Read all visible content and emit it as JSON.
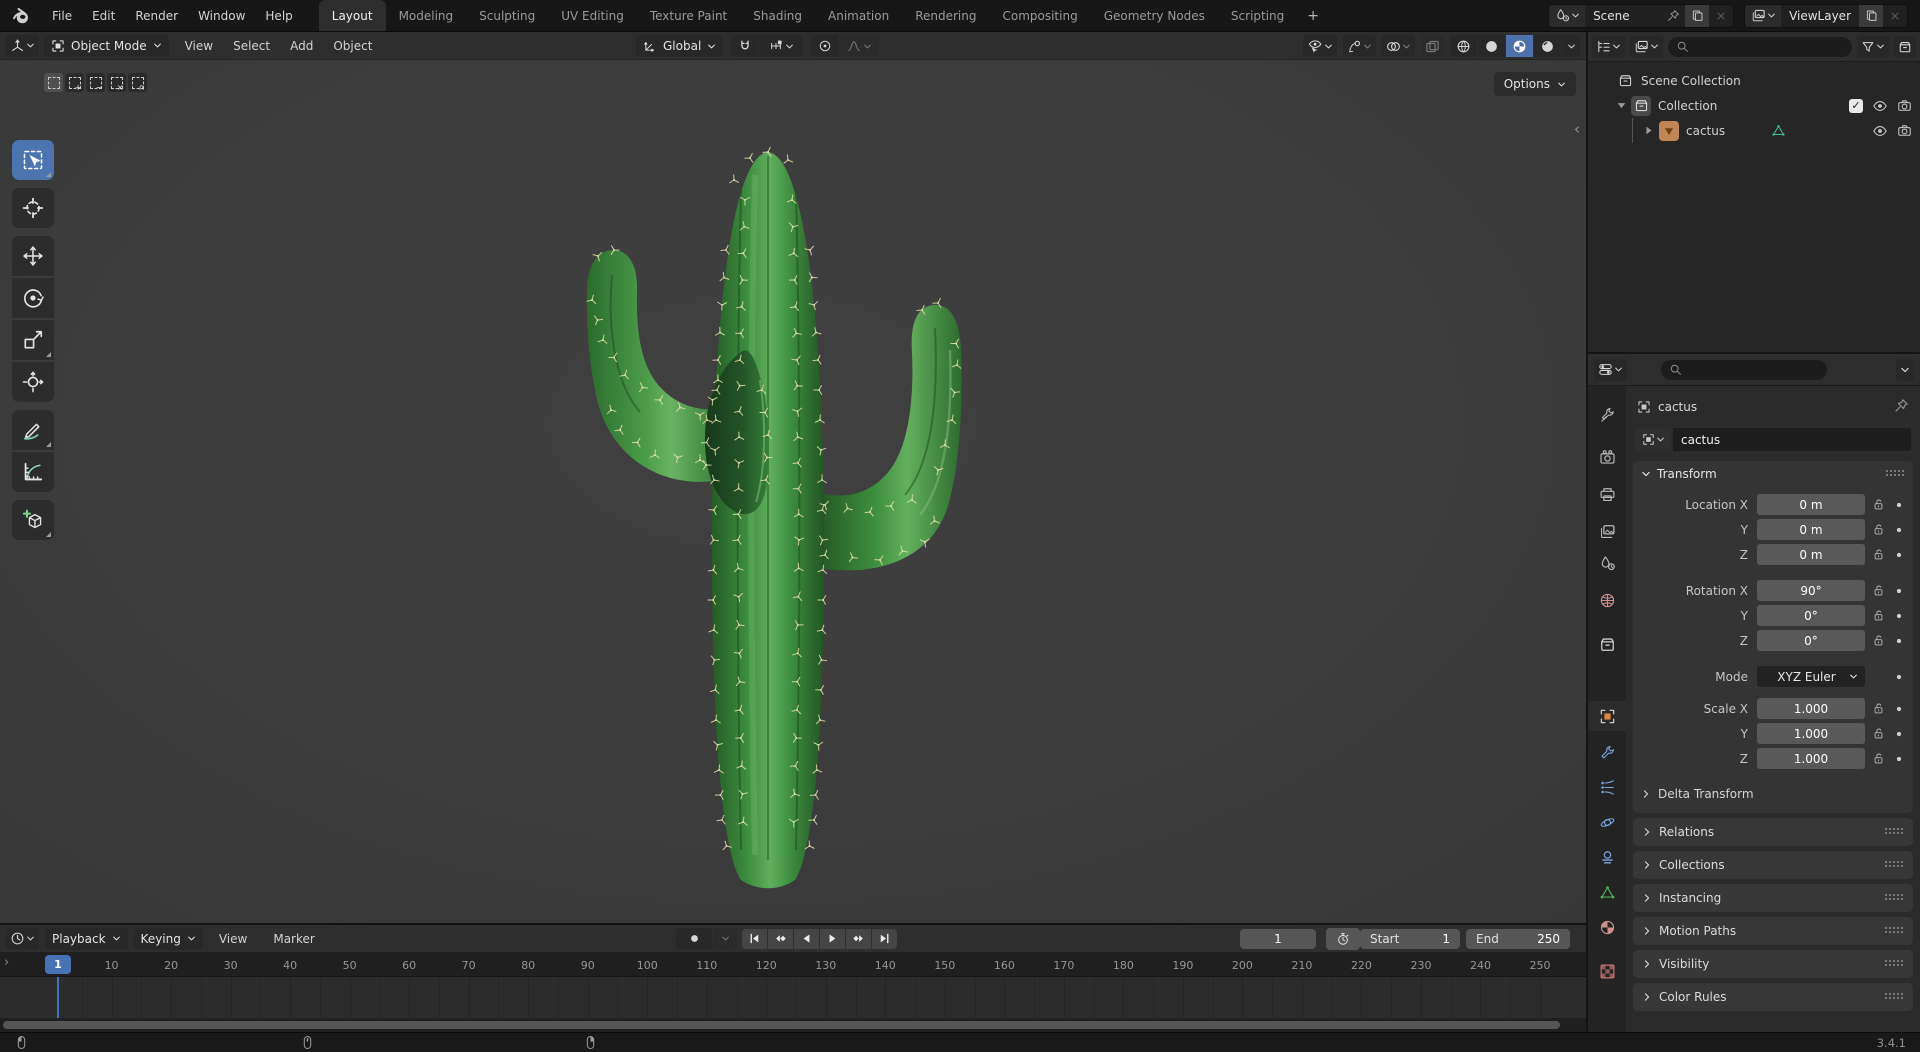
{
  "topbar": {
    "menus": [
      "File",
      "Edit",
      "Render",
      "Window",
      "Help"
    ],
    "workspaces": [
      "Layout",
      "Modeling",
      "Sculpting",
      "UV Editing",
      "Texture Paint",
      "Shading",
      "Animation",
      "Rendering",
      "Compositing",
      "Geometry Nodes",
      "Scripting"
    ],
    "active_workspace": "Layout",
    "new_workspace": "+",
    "scene_selector": {
      "value": "Scene"
    },
    "view_layer_selector": {
      "value": "ViewLayer"
    }
  },
  "viewport": {
    "header": {
      "mode": "Object Mode",
      "menus": [
        "View",
        "Select",
        "Add",
        "Object"
      ],
      "orientation": "Global",
      "shading_modes": [
        "wireframe",
        "solid",
        "material-preview",
        "rendered"
      ],
      "active_shading": "material-preview"
    },
    "options_button": "Options",
    "tools": [
      "box-select",
      "cursor",
      "move",
      "rotate",
      "scale",
      "transform",
      "annotate",
      "measure",
      "add-cube"
    ],
    "active_tool": "box-select",
    "object": "cactus"
  },
  "outliner": {
    "rows": [
      {
        "label": "Scene Collection"
      },
      {
        "label": "Collection",
        "toggles": [
          "checkbox",
          "eye",
          "camera"
        ]
      },
      {
        "label": "cactus",
        "toggles": [
          "eye",
          "camera"
        ]
      }
    ]
  },
  "properties": {
    "active_tab": "object",
    "breadcrumb": "cactus",
    "object_name": "cactus",
    "transform": {
      "title": "Transform",
      "location": {
        "label_x": "Location X",
        "label_y": "Y",
        "label_z": "Z",
        "x": "0 m",
        "y": "0 m",
        "z": "0 m"
      },
      "rotation": {
        "label_x": "Rotation X",
        "label_y": "Y",
        "label_z": "Z",
        "x": "90°",
        "y": "0°",
        "z": "0°"
      },
      "mode": {
        "label": "Mode",
        "value": "XYZ Euler"
      },
      "scale": {
        "label_x": "Scale X",
        "label_y": "Y",
        "label_z": "Z",
        "x": "1.000",
        "y": "1.000",
        "z": "1.000"
      },
      "delta_label": "Delta Transform"
    },
    "panels": [
      "Relations",
      "Collections",
      "Instancing",
      "Motion Paths",
      "Visibility",
      "Color Rules"
    ]
  },
  "timeline": {
    "menus": [
      "Playback",
      "Keying",
      "View",
      "Marker"
    ],
    "current_frame": "1",
    "playhead": "1",
    "start_label": "Start",
    "start_value": "1",
    "end_label": "End",
    "end_value": "250",
    "ruler_ticks": [
      10,
      20,
      30,
      40,
      50,
      60,
      70,
      80,
      90,
      100,
      110,
      120,
      130,
      140,
      150,
      160,
      170,
      180,
      190,
      200,
      210,
      220,
      230,
      240,
      250
    ]
  },
  "statusbar": {
    "version": "3.4.1"
  },
  "colors": {
    "accent": "#4772b3",
    "object_orange": "#cc8550",
    "mesh_green": "#3fbf8f",
    "cactus_green": "#3c8a3e"
  }
}
